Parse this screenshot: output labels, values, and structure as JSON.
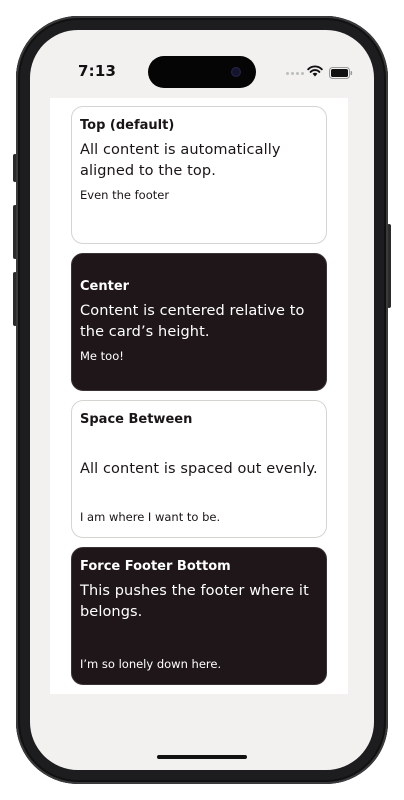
{
  "status_bar": {
    "time": "7:13",
    "icons": [
      "cellular-signal-icon",
      "wifi-icon",
      "battery-icon"
    ]
  },
  "colors": {
    "screen_background": "#f2f1ef",
    "light_card": "#ffffff",
    "dark_card": "#1f161a",
    "light_text": "#1a1516",
    "dark_text": "#ffffff"
  },
  "cards": [
    {
      "title": "Top (default)",
      "body": "All content is automatically aligned to the top.",
      "footer": "Even the footer",
      "theme": "light"
    },
    {
      "title": "Center",
      "body": "Content is centered relative to the card’s height.",
      "footer": "Me too!",
      "theme": "dark"
    },
    {
      "title": "Space Between",
      "body": "All content is spaced out evenly.",
      "footer": "I am where I want to be.",
      "theme": "light"
    },
    {
      "title": "Force Footer Bottom",
      "body": "This pushes the footer where it belongs.",
      "footer": "I’m so lonely down here.",
      "theme": "dark"
    }
  ]
}
